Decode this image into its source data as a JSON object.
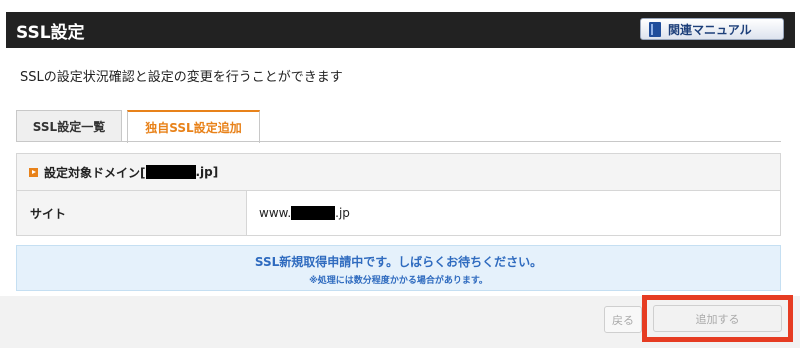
{
  "header": {
    "title": "SSL設定",
    "manual_label": "関連マニュアル"
  },
  "description": "SSLの設定状況確認と設定の変更を行うことができます",
  "tabs": [
    {
      "label": "SSL設定一覧",
      "active": false
    },
    {
      "label": "独自SSL設定追加",
      "active": true
    }
  ],
  "section": {
    "title_prefix": "設定対象ドメイン[",
    "title_suffix": ".jp]",
    "site_label": "サイト",
    "site_prefix": "www.",
    "site_suffix": ".jp"
  },
  "notice": {
    "main": "SSL新規取得申請中です。しばらくお待ちください。",
    "sub": "※処理には数分程度かかる場合があります。"
  },
  "buttons": {
    "back": "戻る",
    "add": "追加する"
  },
  "colors": {
    "header_bg": "#222222",
    "accent": "#e8821a",
    "notice_text": "#2f6bbf",
    "highlight": "#e63c22"
  }
}
